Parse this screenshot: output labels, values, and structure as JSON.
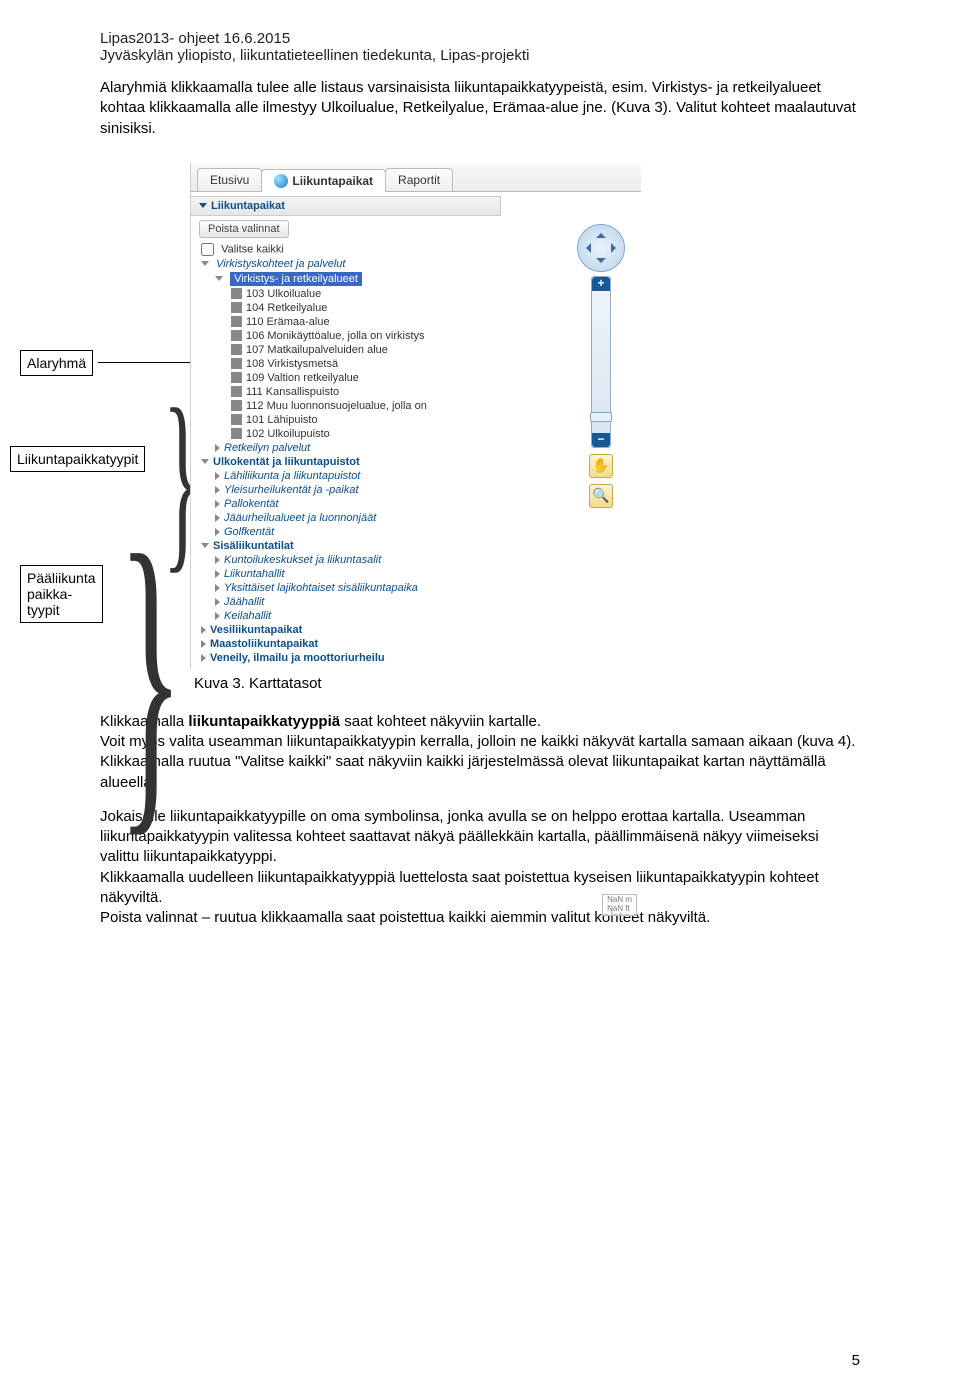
{
  "header": {
    "line1": "Lipas2013- ohjeet 16.6.2015",
    "line2": "Jyväskylän yliopisto, liikuntatieteellinen tiedekunta, Lipas-projekti"
  },
  "intro": {
    "p1a": "Alaryhmiä klikkaamalla tulee alle listaus varsinaisista liikuntapaikkatyypeistä, esim. Virkistys- ja retkeilyalueet kohtaa klikkaamalla alle ilmestyy Ulkoilualue, Retkeilyalue, Erämaa-alue jne. (Kuva 3). Valitut kohteet maalautuvat sinisiksi."
  },
  "callouts": {
    "c1": "Alaryhmä",
    "c2": "Liikuntapaikkatyypit",
    "c3a": "Pääliikunta",
    "c3b": "paikka-",
    "c3c": "tyypit"
  },
  "ui": {
    "tabs": {
      "etusivu": "Etusivu",
      "liikunta": "Liikuntapaikat",
      "raportit": "Raportit"
    },
    "panel": {
      "heading": "Liikuntapaikat",
      "clear": "Poista valinnat",
      "select_all": "Valitse kaikki",
      "group1": "Virkistyskohteet ja palvelut",
      "selected": "Virkistys- ja retkeilyalueet",
      "types": [
        "103 Ulkoilualue",
        "104 Retkeilyalue",
        "110 Erämaa-alue",
        "106 Monikäyttöalue, jolla on virkistys",
        "107 Matkailupalveluiden alue",
        "108 Virkistysmetsä",
        "109 Valtion retkeilyalue",
        "111 Kansallispuisto",
        "112 Muu luonnonsuojelualue, jolla on",
        "101 Lähipuisto",
        "102 Ulkoilupuisto"
      ],
      "sib1": "Retkeilyn palvelut",
      "group2": "Ulkokentät ja liikuntapuistot",
      "g2subs": [
        "Lähiliikunta ja liikuntapuistot",
        "Yleisurheilukentät ja -paikat",
        "Pallokentät",
        "Jääurheilualueet ja luonnonjäät",
        "Golfkentät"
      ],
      "group3": "Sisäliikuntatilat",
      "g3subs": [
        "Kuntoilukeskukset ja liikuntasalit",
        "Liikuntahallit",
        "Yksittäiset lajikohtaiset sisäliikuntapaika",
        "Jäähallit",
        "Keilahallit"
      ],
      "cat4": "Vesiliikuntapaikat",
      "cat5": "Maastoliikuntapaikat",
      "cat6": "Veneily, ilmailu ja moottoriurheilu"
    },
    "nan": {
      "l1": "NaN m",
      "l2": "NaN ft"
    }
  },
  "caption": "Kuva 3. Karttatasot",
  "body": {
    "p1a": "Klikkaamalla ",
    "p1b": "liikuntapaikkatyyppiä",
    "p1c": " saat kohteet näkyviin kartalle.",
    "p2": "Voit myös valita useamman liikuntapaikkatyypin kerralla, jolloin ne kaikki näkyvät kartalla samaan aikaan (kuva 4). Klikkaamalla ruutua \"Valitse kaikki\" saat näkyviin kaikki järjestelmässä olevat liikuntapaikat kartan näyttämällä alueella.",
    "p3": "Jokaiselle liikuntapaikkatyypille on oma symbolinsa, jonka avulla se on helppo erottaa kartalla. Useamman liikuntapaikkatyypin valitessa kohteet saattavat näkyä päällekkäin kartalla, päällimmäisenä näkyy viimeiseksi valittu liikuntapaikkatyyppi.",
    "p4": "Klikkaamalla uudelleen liikuntapaikkatyyppiä luettelosta saat poistettua kyseisen liikuntapaikkatyypin kohteet näkyviltä.",
    "p5": "Poista valinnat – ruutua klikkaamalla saat poistettua kaikki aiemmin valitut kohteet näkyviltä."
  },
  "pagenum": "5"
}
